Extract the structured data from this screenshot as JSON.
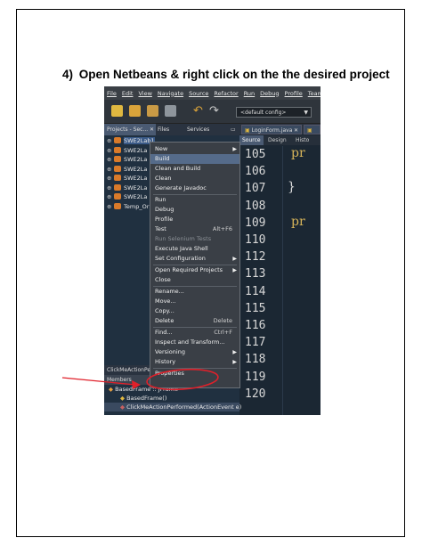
{
  "heading": {
    "number": "4)",
    "text": "Open Netbeans & right click on the the desired project"
  },
  "menubar": [
    "File",
    "Edit",
    "View",
    "Navigate",
    "Source",
    "Refactor",
    "Run",
    "Debug",
    "Profile",
    "Team",
    "T"
  ],
  "toolbar": {
    "config": "<default config>"
  },
  "projects_panel": {
    "tabs": [
      "Projects - Sec...",
      "Files",
      "Services"
    ],
    "items": [
      {
        "label": "SWE2Lab1",
        "selected": true
      },
      {
        "label": "SWE2La"
      },
      {
        "label": "SWE2La"
      },
      {
        "label": "SWE2La"
      },
      {
        "label": "SWE2La"
      },
      {
        "label": "SWE2La"
      },
      {
        "label": "SWE2La"
      },
      {
        "label": "Temp_Or"
      }
    ]
  },
  "context_menu": {
    "items": [
      {
        "label": "New",
        "submenu": true
      },
      {
        "label": "Build",
        "highlighted": true
      },
      {
        "label": "Clean and Build"
      },
      {
        "label": "Clean"
      },
      {
        "label": "Generate Javadoc"
      },
      {
        "sep": true
      },
      {
        "label": "Run"
      },
      {
        "label": "Debug"
      },
      {
        "label": "Profile"
      },
      {
        "label": "Test",
        "shortcut": "Alt+F6"
      },
      {
        "label": "Run Selenium Tests",
        "disabled": true
      },
      {
        "label": "Execute Java Shell"
      },
      {
        "label": "Set Configuration",
        "submenu": true
      },
      {
        "sep": true
      },
      {
        "label": "Open Required Projects",
        "submenu": true
      },
      {
        "label": "Close"
      },
      {
        "sep": true
      },
      {
        "label": "Rename..."
      },
      {
        "label": "Move..."
      },
      {
        "label": "Copy..."
      },
      {
        "label": "Delete",
        "shortcut": "Delete"
      },
      {
        "sep": true
      },
      {
        "label": "Find...",
        "shortcut": "Ctrl+F"
      },
      {
        "label": "Inspect and Transform..."
      },
      {
        "label": "Versioning",
        "submenu": true
      },
      {
        "label": "History",
        "submenu": true
      },
      {
        "sep": true
      },
      {
        "label": "Properties"
      }
    ]
  },
  "navigator": {
    "title": "ClickMeActionPer",
    "members_label": "Members",
    "rows": [
      "BasedFrame :: JFrame",
      "BasedFrame()",
      "ClickMeActionPerformed(ActionEvent e)"
    ]
  },
  "editor": {
    "tabs": [
      "LoginForm.java"
    ],
    "views": [
      "Source",
      "Design",
      "Histo"
    ],
    "line_numbers": [
      "105",
      "106",
      "107",
      "108",
      "109",
      "110",
      "112",
      "113",
      "114",
      "115",
      "116",
      "117",
      "118",
      "119",
      "120"
    ],
    "code_lines": [
      {
        "line": 0,
        "text": "pr"
      },
      {
        "line": 2,
        "text": "}"
      },
      {
        "line": 4,
        "text": "pr"
      }
    ]
  },
  "colors": {
    "annotation": "#e0202a",
    "accent": "#556b8a"
  }
}
